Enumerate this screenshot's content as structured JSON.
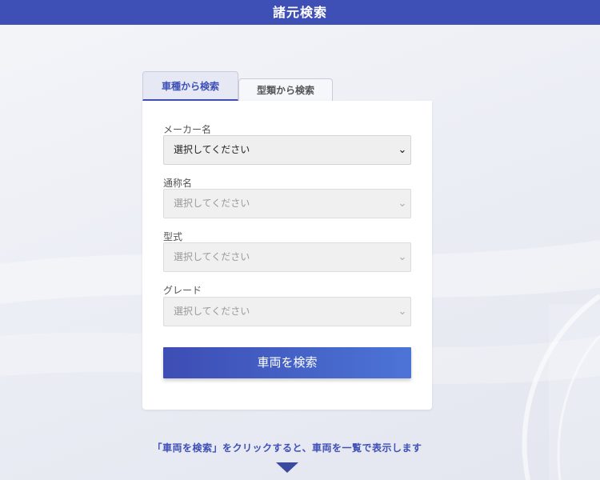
{
  "header": {
    "title": "諸元検索"
  },
  "tabs": [
    {
      "label": "車種から検索",
      "active": true
    },
    {
      "label": "型類から検索",
      "active": false
    }
  ],
  "form": {
    "fields": [
      {
        "label": "メーカー名",
        "value": "選択してください",
        "enabled": true
      },
      {
        "label": "通称名",
        "value": "選択してください",
        "enabled": false
      },
      {
        "label": "型式",
        "value": "選択してください",
        "enabled": false
      },
      {
        "label": "グレード",
        "value": "選択してください",
        "enabled": false
      }
    ],
    "submit_label": "車両を検索"
  },
  "hint": {
    "text": "「車両を検索」をクリックすると、車両を一覧で表示します"
  },
  "icons": {
    "dropdown": "chevron-down-icon",
    "scroll_hint": "triangle-down-icon"
  },
  "colors": {
    "accent": "#3e4fb6",
    "button_end": "#4c74d6"
  }
}
